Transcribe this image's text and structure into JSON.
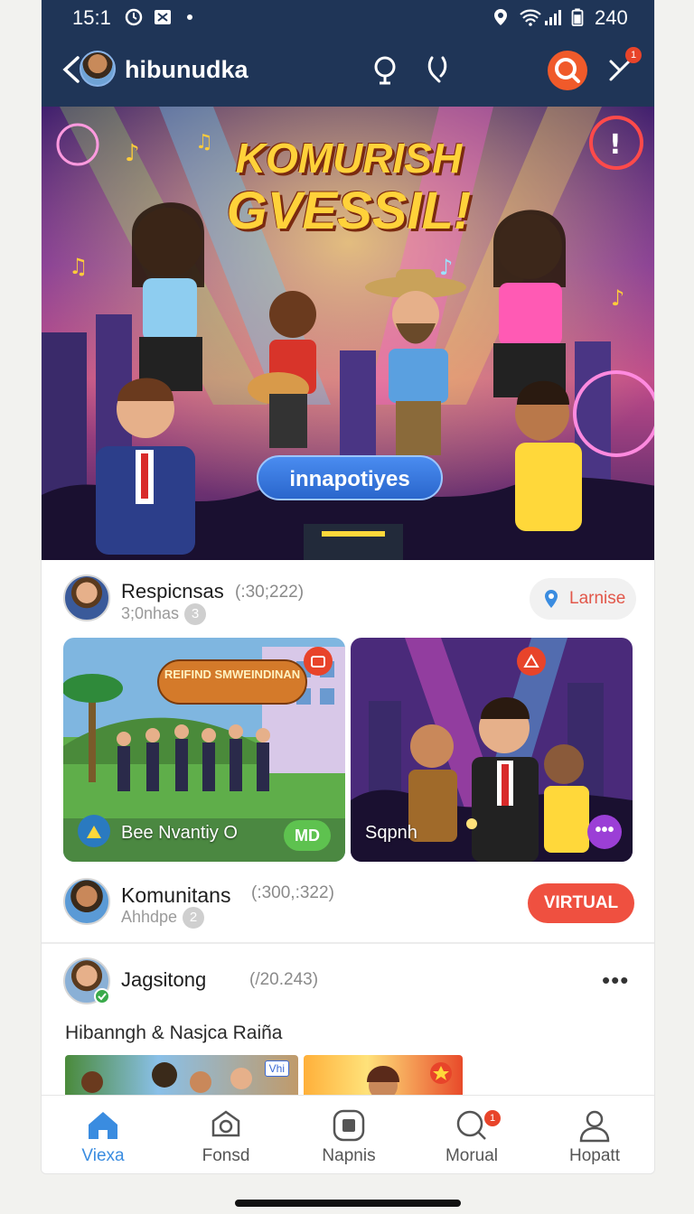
{
  "status_bar": {
    "time": "15:1",
    "battery": "240"
  },
  "header": {
    "title": "hibunudka",
    "notification_count": "1"
  },
  "hero": {
    "title_line1": "KOMURISH",
    "title_line2": "GVESSIL!",
    "pill_label": "innapotiyes"
  },
  "post1": {
    "name": "Respicnsas",
    "meta": "(:30;222)",
    "sub": "3;0nhas",
    "count": "3",
    "location_pill": "Larnise",
    "cards": [
      {
        "label": "Bee Nvantiy O",
        "tag": "MD",
        "speech": "REIFIND SMWEINDINAN"
      },
      {
        "label": "Sqpnh"
      }
    ]
  },
  "post2": {
    "name": "Komunitans",
    "meta": "(:300,:322)",
    "sub": "Ahhdpe",
    "count": "2",
    "action_pill": "VIRTUAL"
  },
  "post3": {
    "name": "Jagsitong",
    "meta": "(/20.243)",
    "more": "•••",
    "caption": "Hibanngh & Nasjca Raiña",
    "thumb_badge": "Vhi"
  },
  "bottom_nav": [
    {
      "label": "Viexa",
      "icon": "home-icon",
      "active": true
    },
    {
      "label": "Fonsd",
      "icon": "camera-icon"
    },
    {
      "label": "Napnis",
      "icon": "square-icon"
    },
    {
      "label": "Morual",
      "icon": "chat-icon",
      "badge": "1"
    },
    {
      "label": "Hopatt",
      "icon": "profile-icon"
    }
  ],
  "colors": {
    "header_bg": "#1f3557",
    "accent_red": "#ef5040",
    "accent_blue": "#3a8ce0",
    "tag_green": "#5ec24f"
  }
}
